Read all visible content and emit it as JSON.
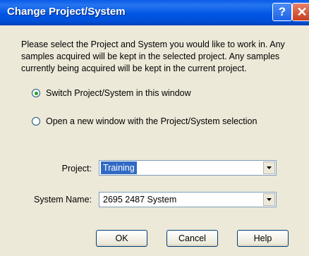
{
  "window": {
    "title": "Change Project/System",
    "help_glyph": "?",
    "close_glyph": "✕"
  },
  "description": {
    "lines": [
      "Please select the Project and System you would like to work in. Any",
      "samples acquired will be kept in the selected project. Any samples",
      "currently being acquired will be kept in the current project."
    ]
  },
  "options": [
    {
      "label": "Switch Project/System in this window",
      "selected": true
    },
    {
      "label": "Open a new window with the Project/System selection",
      "selected": false
    }
  ],
  "project": {
    "label": "Project:",
    "value": "Training"
  },
  "system": {
    "label": "System Name:",
    "value": "2695 2487 System"
  },
  "buttons": {
    "ok": "OK",
    "cancel": "Cancel",
    "help": "Help"
  },
  "colors": {
    "titlebar": "#0055e5",
    "selection": "#316ac5",
    "background": "#ece9d8"
  }
}
